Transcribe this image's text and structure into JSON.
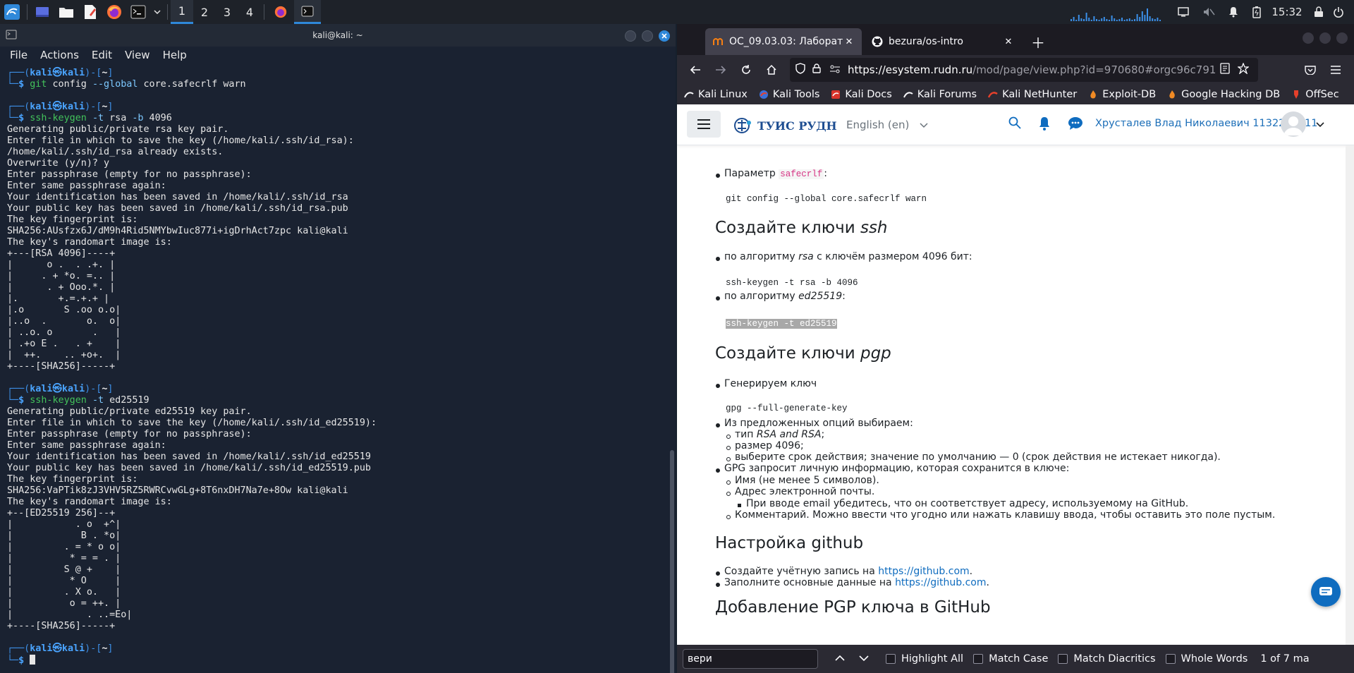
{
  "taskbar": {
    "workspaces": [
      "1",
      "2",
      "3",
      "4"
    ],
    "clock": "15:32"
  },
  "terminal": {
    "title": "kali@kali: ~",
    "menu": [
      "File",
      "Actions",
      "Edit",
      "View",
      "Help"
    ],
    "prompt": {
      "user": "kali",
      "at": "㉿",
      "host": "kali",
      "dir": "~"
    },
    "commands": [
      "git config --global core.safecrlf warn",
      "ssh-keygen -t rsa -b 4096",
      "ssh-keygen -t ed25519"
    ],
    "rsa_output": [
      "Generating public/private rsa key pair.",
      "Enter file in which to save the key (/home/kali/.ssh/id_rsa):",
      "/home/kali/.ssh/id_rsa already exists.",
      "Overwrite (y/n)? y",
      "Enter passphrase (empty for no passphrase):",
      "Enter same passphrase again:",
      "Your identification has been saved in /home/kali/.ssh/id_rsa",
      "Your public key has been saved in /home/kali/.ssh/id_rsa.pub",
      "The key fingerprint is:",
      "SHA256:AUsfzx6J/dM9h4Rid5NMYbwIuc877i+igDrhAct7zpc kali@kali",
      "The key's randomart image is:",
      "+---[RSA 4096]----+",
      "|      o .  . .+. |",
      "|     . + *o. =.. |",
      "|      . + Ooo.*. |",
      "|.       +.=.+.+ |",
      "|.o       S .oo o.o|",
      "|..o  .       o.  o|",
      "| ..o. o       .   |",
      "| .+o E .   . +    |",
      "|  ++.    .. +o+.  |",
      "+----[SHA256]-----+"
    ],
    "ed_output": [
      "Generating public/private ed25519 key pair.",
      "Enter file in which to save the key (/home/kali/.ssh/id_ed25519):",
      "Enter passphrase (empty for no passphrase):",
      "Enter same passphrase again:",
      "Your identification has been saved in /home/kali/.ssh/id_ed25519",
      "Your public key has been saved in /home/kali/.ssh/id_ed25519.pub",
      "The key fingerprint is:",
      "SHA256:VaPTik8zJ3VHV5RZ5RWRCvwGLg+8T6nxDH7Na7e+8Ow kali@kali",
      "The key's randomart image is:",
      "+--[ED25519 256]--+",
      "|           . o  +^|",
      "|            B . *o|",
      "|         . = * o o|",
      "|          * = = . |",
      "|         S @ +    |",
      "|          * O     |",
      "|         . X o.   |",
      "|          o = ++. |",
      "|             . ..=Eo|",
      "+----[SHA256]-----+"
    ]
  },
  "browser": {
    "tabs": [
      {
        "title": "ОС_09.03.03: Лаборатор",
        "active": true
      },
      {
        "title": "bezura/os-intro",
        "active": false
      }
    ],
    "url_host": "https://esystem.rudn.ru",
    "url_path": "/mod/page/view.php?id=970680#orgc96c791",
    "bookmarks": [
      "Kali Linux",
      "Kali Tools",
      "Kali Docs",
      "Kali Forums",
      "Kali NetHunter",
      "Exploit-DB",
      "Google Hacking DB",
      "OffSec"
    ],
    "site": {
      "logo": "ТУИС РУДН",
      "language": "English (en)",
      "user": "Хрусталев Влад Николаевич 1132222011"
    },
    "content": {
      "param_label": "Параметр ",
      "param_code": "safecrlf",
      "param_colon": ":",
      "code_safecrlf": "git config --global core.safecrlf warn",
      "h_ssh": "Создайте ключи ",
      "h_ssh_em": "ssh",
      "ssh_rsa_a": "по алгоритму ",
      "ssh_rsa_em": "rsa",
      "ssh_rsa_b": " с ключём размером 4096 бит:",
      "code_rsa": "ssh-keygen -t rsa -b 4096",
      "ssh_ed_a": "по алгоритму ",
      "ssh_ed_em": "ed25519",
      "ssh_ed_b": ":",
      "code_ed": "ssh-keygen -t ed25519",
      "h_pgp": "Создайте ключи ",
      "h_pgp_em": "pgp",
      "gen_key": "Генерируем ключ",
      "code_gpg": "gpg --full-generate-key",
      "options": "Из предложенных опций выбираем:",
      "opt_type_a": "тип ",
      "opt_type_em": "RSA and RSA",
      "opt_type_b": ";",
      "opt_size": "размер 4096;",
      "opt_expire": "выберите срок действия; значение по умолчанию — 0 (срок действия не истекает никогда).",
      "gpg_info": "GPG запросит личную информацию, которая сохранится в ключе:",
      "gpg_name": "Имя (не менее 5 символов).",
      "gpg_email": "Адрес электронной почты.",
      "gpg_email_note": "При вводе email убедитесь, что он соответствует адресу, используемому на GitHub.",
      "gpg_comment": "Комментарий. Можно ввести что угодно или нажать клавишу ввода, чтобы оставить это поле пустым.",
      "h_github": "Настройка github",
      "gh_create": "Создайте учётную запись на ",
      "gh_link": "https://github.com",
      "gh_dot": ".",
      "gh_fill": "Заполните основные данные на ",
      "gh_link2": "https://github.com",
      "gh_dot2": ".",
      "h_pgp_github": "Добавление PGP ключа в GitHub"
    },
    "findbar": {
      "query": "вери",
      "highlight_all": "Highlight All",
      "match_case": "Match Case",
      "match_diacritics": "Match Diacritics",
      "whole_words": "Whole Words",
      "status": "1 of 7 ma"
    }
  }
}
